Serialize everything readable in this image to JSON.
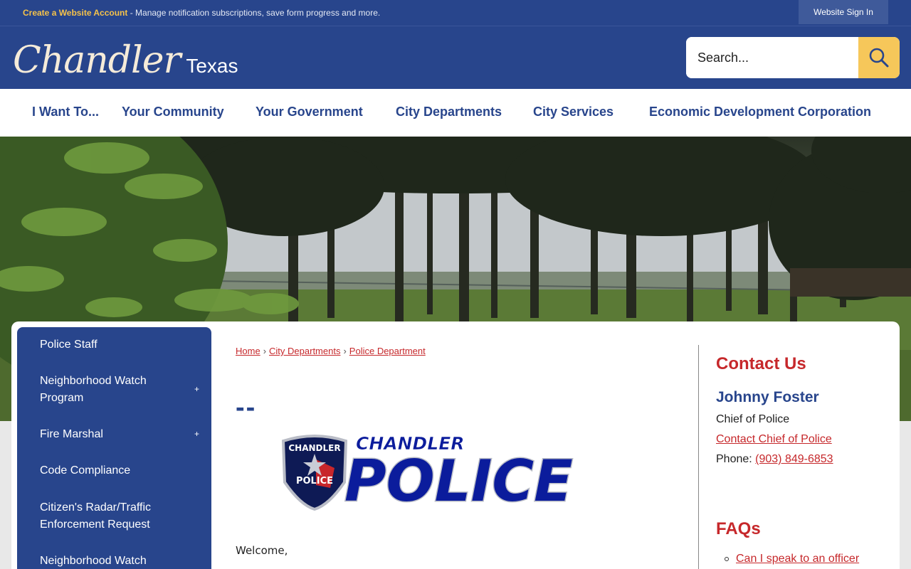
{
  "topbar": {
    "create_account_link": "Create a Website Account",
    "message": " - Manage notification subscriptions, save form progress and more.",
    "signin_label": "Website Sign In"
  },
  "header": {
    "logo_script": "Chandler",
    "logo_state": "Texas",
    "search_placeholder": "Search..."
  },
  "nav": {
    "items": [
      "I Want To...",
      "Your Community",
      "Your Government",
      "City Departments",
      "City Services",
      "Economic Development Corporation"
    ]
  },
  "sidebar": {
    "items": [
      {
        "label": "Police Staff"
      },
      {
        "label": "Neighborhood Watch Program",
        "expand": "+"
      },
      {
        "label": "Fire Marshal",
        "expand": "+"
      },
      {
        "label": "Code Compliance"
      },
      {
        "label": "Citizen's Radar/Traffic Enforcement Request"
      },
      {
        "label": "Neighborhood Watch"
      }
    ]
  },
  "breadcrumb": {
    "items": [
      "Home",
      "City Departments",
      "Police Department"
    ],
    "separator": "›"
  },
  "main": {
    "title": "--",
    "logo_top_text": "CHANDLER",
    "logo_main_text": "POLICE",
    "badge_top_text": "CHANDLER",
    "badge_bottom_text": "POLICE",
    "welcome": "Welcome,"
  },
  "contact": {
    "heading": "Contact Us",
    "name": "Johnny Foster",
    "title": "Chief of Police",
    "link": "Contact Chief of Police",
    "phone_label": "Phone: ",
    "phone": "(903) 849-6853"
  },
  "faqs": {
    "heading": "FAQs",
    "items": [
      "Can I speak to an officer"
    ]
  },
  "colors": {
    "primary_blue": "#28458c",
    "accent_yellow": "#f6c75a",
    "link_red": "#c6282b"
  }
}
